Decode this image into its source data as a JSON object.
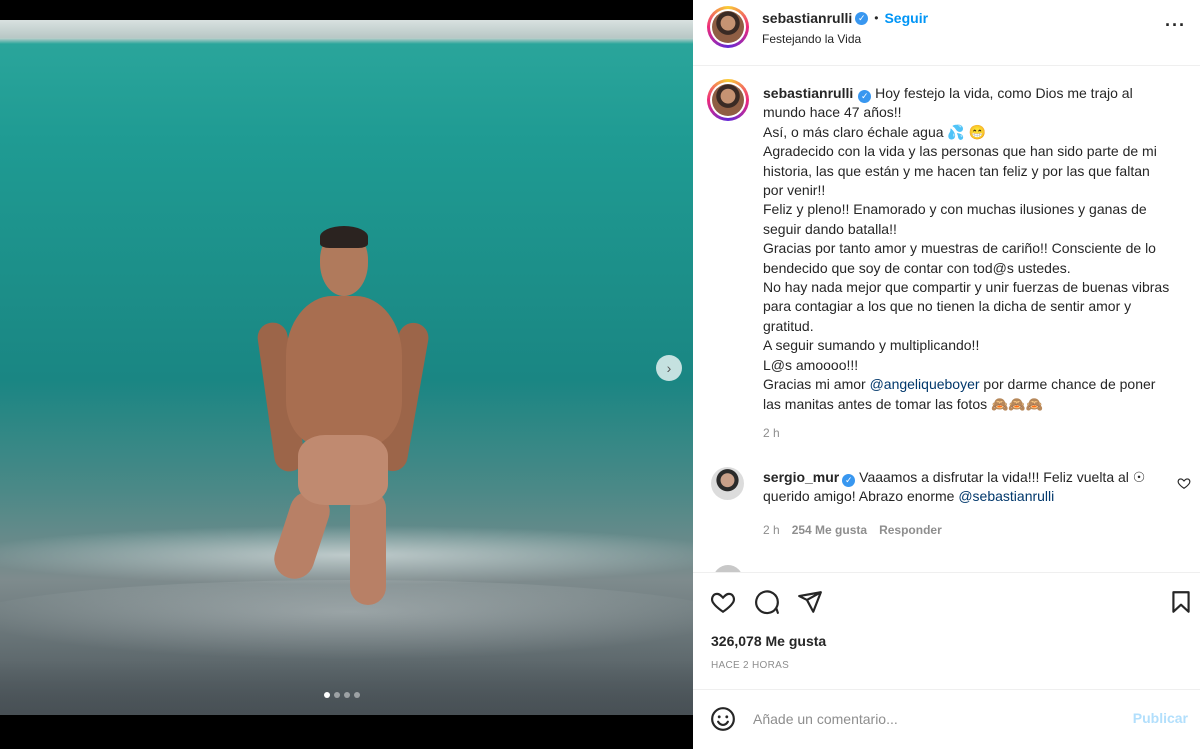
{
  "header": {
    "username": "sebastianrulli",
    "separator": "•",
    "follow_label": "Seguir",
    "location": "Festejando la Vida",
    "more_icon": "more-horizontal-icon"
  },
  "caption": {
    "username": "sebastianrulli",
    "lines": [
      "Hoy festejo la vida, como Dios me trajo al mundo hace 47 años!!",
      "Así, o más claro échale agua 💦 😁",
      "Agradecido con la vida y las personas que han sido parte de mi historia, las que están y me hacen tan feliz y por las que faltan por venir!!",
      "Feliz y pleno!! Enamorado y con muchas ilusiones y ganas de seguir dando batalla!!",
      "Gracias por tanto amor y muestras de cariño!! Consciente de lo bendecido que soy de contar con tod@s ustedes.",
      "No hay nada mejor que compartir y unir fuerzas de buenas vibras para contagiar a los que no tienen la dicha de sentir amor y gratitud.",
      "A seguir sumando y multiplicando!!",
      "L@s amoooo!!!"
    ],
    "last_line_prefix": "Gracias mi amor ",
    "last_line_mention": "@angeliqueboyer",
    "last_line_suffix": " por darme chance de poner las manitas antes de tomar las fotos 🙈🙈🙈",
    "time": "2 h"
  },
  "comment": {
    "username": "sergio_mur",
    "text": "Vaaamos a disfrutar la vida!!! Feliz vuelta al ☉ querido amigo! Abrazo enorme ",
    "mention": "@sebastianrulli",
    "time": "2 h",
    "likes": "254 Me gusta",
    "reply_label": "Responder"
  },
  "actions": {
    "likes": "326,078 Me gusta",
    "ago": "HACE 2 HORAS"
  },
  "add_comment": {
    "placeholder": "Añade un comentario...",
    "publish_label": "Publicar"
  },
  "media": {
    "next_icon": "chevron-right-icon",
    "carousel_count": 4,
    "carousel_active": 1
  },
  "colors": {
    "link": "#0095f6",
    "mention": "#00376b",
    "verified": "#3897f0",
    "muted": "#8e8e8e",
    "publish_disabled": "#b2dffc"
  }
}
